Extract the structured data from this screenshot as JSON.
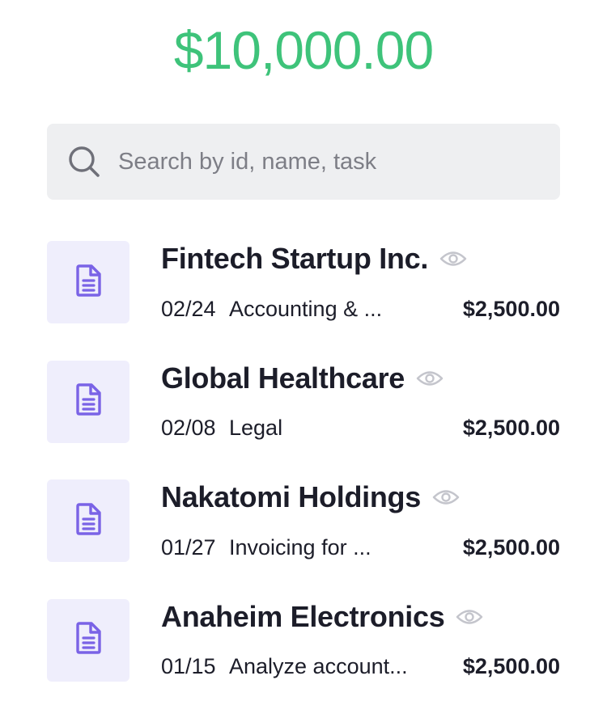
{
  "balance": {
    "amount": "$10,000.00",
    "color": "#3ec37a"
  },
  "search": {
    "placeholder": "Search by id, name, task",
    "value": "",
    "icon": "search-icon"
  },
  "colors": {
    "accent": "#7a63e6",
    "tile_background": "#efeefc",
    "eye_icon": "#c4c5cc"
  },
  "items": [
    {
      "title": "Fintech Startup Inc.",
      "date": "02/24",
      "task": "Accounting & ...",
      "amount": "$2,500.00",
      "icon": "document-icon",
      "view_icon": "eye-icon"
    },
    {
      "title": "Global Healthcare",
      "date": "02/08",
      "task": "Legal",
      "amount": "$2,500.00",
      "icon": "document-icon",
      "view_icon": "eye-icon"
    },
    {
      "title": "Nakatomi Holdings",
      "date": "01/27",
      "task": "Invoicing for ...",
      "amount": "$2,500.00",
      "icon": "document-icon",
      "view_icon": "eye-icon"
    },
    {
      "title": "Anaheim Electronics",
      "date": "01/15",
      "task": "Analyze account...",
      "amount": "$2,500.00",
      "icon": "document-icon",
      "view_icon": "eye-icon"
    }
  ]
}
